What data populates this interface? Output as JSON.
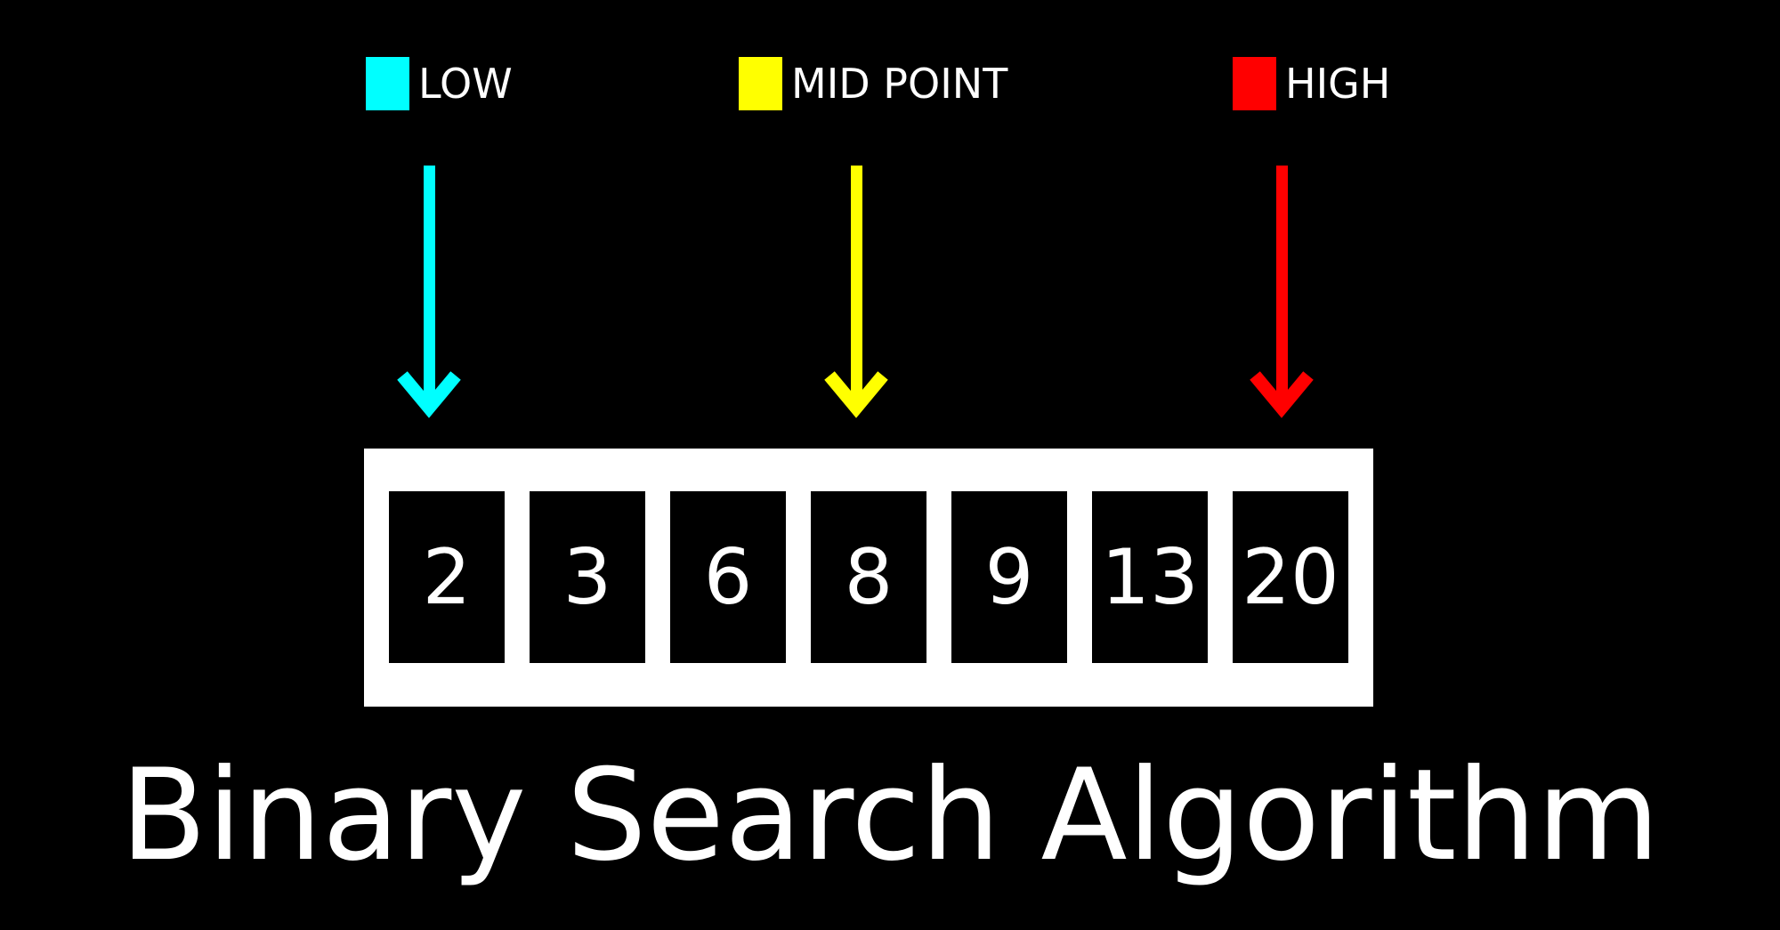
{
  "legend": {
    "low": {
      "label": "LOW",
      "color": "#00ffff"
    },
    "mid": {
      "label": "MID POINT",
      "color": "#ffff00"
    },
    "high": {
      "label": "HIGH",
      "color": "#ff0000"
    }
  },
  "pointers": {
    "low_index": 0,
    "mid_index": 3,
    "high_index": 6
  },
  "array": {
    "values": [
      "2",
      "3",
      "6",
      "8",
      "9",
      "13",
      "20"
    ]
  },
  "title": "Binary Search Algorithm"
}
